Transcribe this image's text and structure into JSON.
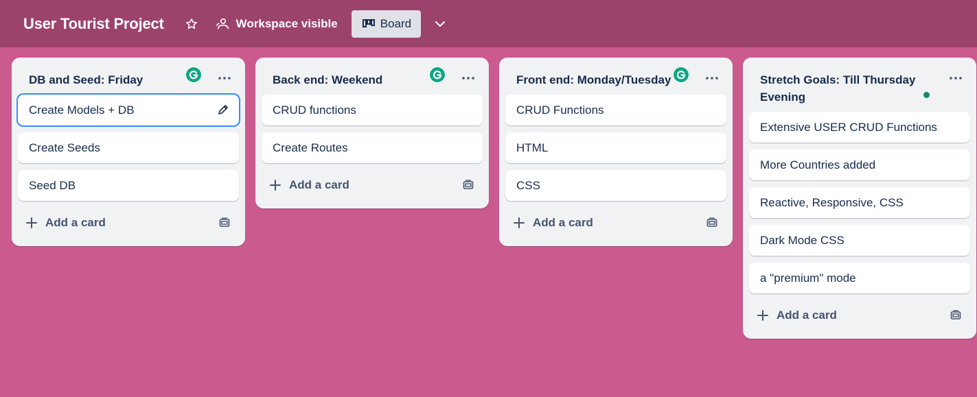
{
  "header": {
    "board_title": "User Tourist Project",
    "visibility_label": "Workspace visible",
    "view_label": "Board"
  },
  "lists": [
    {
      "title": "DB and Seed: Friday",
      "cards": [
        "Create Models + DB",
        "Create Seeds",
        "Seed DB"
      ],
      "add_label": "Add a card"
    },
    {
      "title": "Back end: Weekend",
      "cards": [
        "CRUD functions",
        "Create Routes"
      ],
      "add_label": "Add a card"
    },
    {
      "title": "Front end: Monday/Tuesday",
      "cards": [
        "CRUD Functions",
        "HTML",
        "CSS"
      ],
      "add_label": "Add a card"
    },
    {
      "title": "Stretch Goals: Till Thursday Evening",
      "cards": [
        "Extensive USER CRUD Functions",
        "More Countries added",
        "Reactive, Responsive, CSS",
        "Dark Mode CSS",
        "a \"premium\" mode"
      ],
      "add_label": "Add a card"
    }
  ],
  "colors": {
    "board_background": "#cb5a8f",
    "header_background": "#9c436c",
    "list_background": "#f1f2f4",
    "focus_ring": "#388bff",
    "grammarly_badge": "#11a683"
  },
  "icons": {
    "favorite": "star-icon",
    "visibility": "people-icon",
    "view": "board-icon",
    "view_switch": "chevron-down-icon",
    "list_menu": "ellipsis-icon",
    "add_card": "plus-icon",
    "template": "card-template-icon",
    "edit_card": "pencil-icon",
    "extension_badge": "grammarly-icon"
  }
}
